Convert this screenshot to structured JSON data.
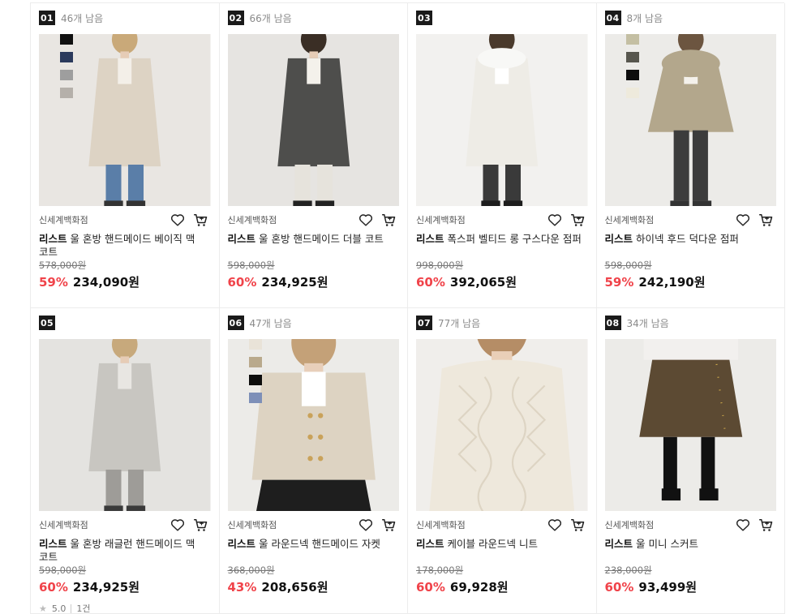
{
  "products": [
    {
      "rank": "01",
      "stock": "46개 남음",
      "dept": "신세계백화점",
      "brand": "리스트",
      "name": "울 혼방 핸드메이드 베이직 맥 코트",
      "original_price": "578,000원",
      "discount": "59%",
      "price": "234,090원",
      "swatches": [
        "#111111",
        "#2b3a5c",
        "#9e9e9e",
        "#b5b0aa"
      ],
      "photo": {
        "bg": "#e9e6e2",
        "coat": "#ddd3c4",
        "pants": "#5a7ea8",
        "shoes": "#333333",
        "hair": "#c9a979",
        "inner": "#f3efe8"
      }
    },
    {
      "rank": "02",
      "stock": "66개 남음",
      "dept": "신세계백화점",
      "brand": "리스트",
      "name": "울 혼방 핸드메이드 더블 코트",
      "original_price": "598,000원",
      "discount": "60%",
      "price": "234,925원",
      "swatches": [],
      "photo": {
        "bg": "#e6e4e1",
        "coat": "#4e4e4c",
        "pants": "#e6e3dc",
        "shoes": "#222222",
        "hair": "#3a2e25",
        "inner": "#f4f1eb"
      }
    },
    {
      "rank": "03",
      "stock": "",
      "dept": "신세계백화점",
      "brand": "리스트",
      "name": "폭스퍼 벨티드 롱 구스다운 점퍼",
      "original_price": "998,000원",
      "discount": "60%",
      "price": "392,065원",
      "swatches": [],
      "photo": {
        "bg": "#f2f1ef",
        "coat": "#eeece6",
        "pants": "#3a3a3a",
        "shoes": "#1d1d1d",
        "hair": "#4a3a2c",
        "inner": "#ffffff"
      }
    },
    {
      "rank": "04",
      "stock": "8개 남음",
      "dept": "신세계백화점",
      "brand": "리스트",
      "name": "하이넥 후드 덕다운 점퍼",
      "original_price": "598,000원",
      "discount": "59%",
      "price": "242,190원",
      "swatches": [
        "#c4bfa3",
        "#57564e",
        "#0d0d0d",
        "#eeeadc"
      ],
      "photo": {
        "bg": "#ecebe8",
        "coat": "#b3a78c",
        "pants": "#3c3c3c",
        "shoes": "#333333",
        "hair": "#6c5540",
        "inner": "#f4f1eb"
      }
    },
    {
      "rank": "05",
      "stock": "",
      "dept": "신세계백화점",
      "brand": "리스트",
      "name": "울 혼방 래글런 핸드메이드 맥 코트",
      "original_price": "598,000원",
      "discount": "60%",
      "price": "234,925원",
      "swatches": [],
      "rating": "5.0",
      "reviews": "1건",
      "photo": {
        "bg": "#e4e3e0",
        "coat": "#c8c6c1",
        "pants": "#9e9c98",
        "shoes": "#3a3a3a",
        "hair": "#c7a97c",
        "inner": "#e8e6e2"
      }
    },
    {
      "rank": "06",
      "stock": "47개 남음",
      "dept": "신세계백화점",
      "brand": "리스트",
      "name": "울 라운드넥 핸드메이드 자켓",
      "original_price": "368,000원",
      "discount": "43%",
      "price": "208,656원",
      "swatches": [
        "#e9e3d8",
        "#b9a98c",
        "#0d0d0d",
        "#7d8fb8"
      ],
      "photo": {
        "bg": "#ecebe8",
        "coat": "#ddd3c2",
        "pants": "#1e1e1e",
        "shoes": "#222222",
        "hair": "#c4a178",
        "inner": "#ffffff"
      }
    },
    {
      "rank": "07",
      "stock": "77개 남음",
      "dept": "신세계백화점",
      "brand": "리스트",
      "name": "케이블 라운드넥 니트",
      "original_price": "178,000원",
      "discount": "60%",
      "price": "69,928원",
      "swatches": [],
      "photo": {
        "bg": "#f0eeeb",
        "coat": "#eee8dc",
        "pants": "#d8d4cc",
        "shoes": "#333333",
        "hair": "#b58d66",
        "inner": "#eee8dc"
      }
    },
    {
      "rank": "08",
      "stock": "34개 남음",
      "dept": "신세계백화점",
      "brand": "리스트",
      "name": "울 미니 스커트",
      "original_price": "238,000원",
      "discount": "60%",
      "price": "93,499원",
      "swatches": [],
      "photo": {
        "bg": "#ecebe8",
        "coat": "#5c4a33",
        "pants": "#111111",
        "shoes": "#111111",
        "hair": "#2e2e2e",
        "inner": "#ffffff"
      }
    }
  ]
}
